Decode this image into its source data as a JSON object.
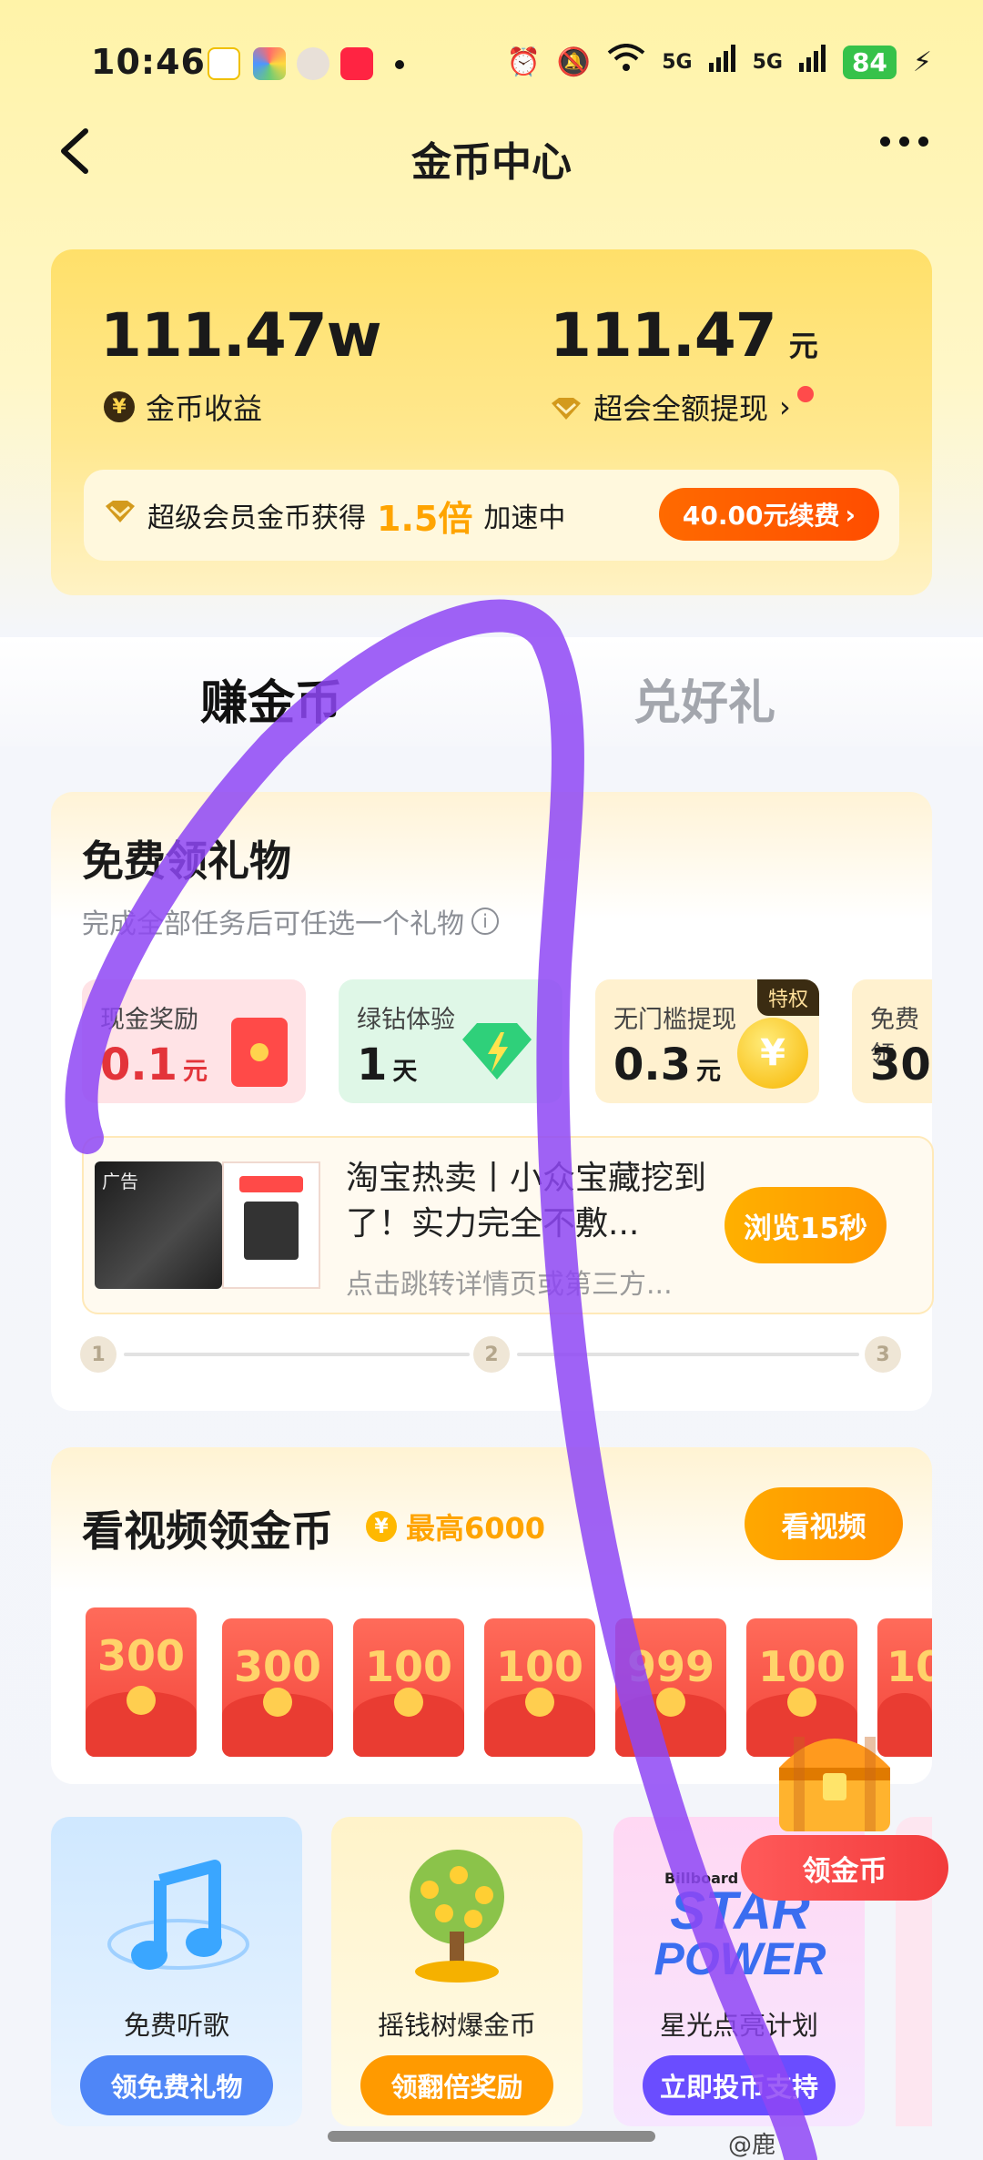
{
  "status_bar": {
    "time": "10:46",
    "battery": "84",
    "network_1": "5G",
    "network_2": "5G",
    "apps": [
      "weibo-icon",
      "photos-icon",
      "avatar-icon",
      "xiaohongshu-icon"
    ]
  },
  "nav": {
    "title": "金币中心"
  },
  "summary": {
    "coins_value": "111.47w",
    "coins_label": "金币收益",
    "cash_value": "111.47",
    "cash_unit": "元",
    "cash_label": "超会全额提现",
    "member_text_prefix": "超级会员金币获得",
    "member_multiplier": "1.5倍",
    "member_text_suffix": "加速中",
    "renew_label": "40.00元续费",
    "colors": {
      "accent": "#ff5a00",
      "gold": "#ffa400"
    }
  },
  "tabs": [
    {
      "label": "赚金币",
      "active": true
    },
    {
      "label": "兑好礼",
      "active": false
    }
  ],
  "gift_section": {
    "title": "免费领礼物",
    "subtitle": "完成全部任务后可任选一个礼物",
    "rewards": [
      {
        "label": "现金奖励",
        "value": "0.1",
        "unit": "元",
        "bg": "#ffe3e6"
      },
      {
        "label": "绿钻体验",
        "value": "1",
        "unit": "天",
        "bg": "#dff7e7"
      },
      {
        "label": "无门槛提现",
        "value": "0.3",
        "unit": "元",
        "bg": "#fff1cf",
        "badge": "特权"
      },
      {
        "label": "免费领",
        "value": "30",
        "unit": "",
        "bg": "#fff1cf"
      }
    ],
    "ad": {
      "tag": "广告",
      "title": "淘宝热卖丨小众宝藏挖到了！实力完全不敷...",
      "subtitle": "点击跳转详情页或第三方...",
      "button": "浏览15秒"
    },
    "steps": [
      "1",
      "2",
      "3"
    ]
  },
  "video_section": {
    "title": "看视频领金币",
    "max_label": "最高6000",
    "button": "看视频",
    "envelopes": [
      "300",
      "300",
      "100",
      "100",
      "999",
      "100",
      "10"
    ]
  },
  "floating": {
    "button": "领金币"
  },
  "features": [
    {
      "label": "免费听歌",
      "button": "领免费礼物",
      "btn_color": "#4f86f7"
    },
    {
      "label": "摇钱树爆金币",
      "button": "领翻倍奖励",
      "btn_color": "#ff9a00"
    },
    {
      "label": "星光点亮计划",
      "button": "立即投币支持",
      "btn_color": "#6a4dff",
      "poster_line1": "STAR",
      "poster_line2": "POWER",
      "poster_small": "Billboard China"
    }
  ],
  "watermark": "@鹿"
}
